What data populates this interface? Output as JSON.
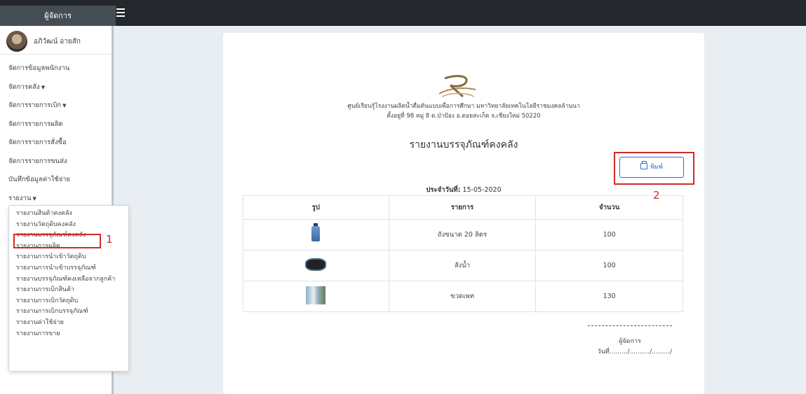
{
  "topbar": {
    "brand": "ผู้จัดการ"
  },
  "user": {
    "name": "อภิวัฒน์ อายสัก"
  },
  "nav": [
    {
      "label": "จัดการข้อมูลพนักงาน",
      "caret": ""
    },
    {
      "label": "จัดการคลัง",
      "caret": "▼"
    },
    {
      "label": "จัดการรายการเบิก",
      "caret": "▼"
    },
    {
      "label": "จัดการรายการผลิต",
      "caret": ""
    },
    {
      "label": "จัดการรายการสั่งซื้อ",
      "caret": ""
    },
    {
      "label": "จัดการรายการขนส่ง",
      "caret": ""
    },
    {
      "label": "บันทึกข้อมูลค่าใช้จ่าย",
      "caret": ""
    },
    {
      "label": "รายงาน",
      "caret": "▼"
    }
  ],
  "report_menu": [
    "รายงานสินค้าคงคลัง",
    "รายงานวัตถุดิบคงคลัง",
    "รายงานบรรจุภัณฑ์คงคลัง",
    "รายงานการผลิต",
    "รายงานการนำเข้าวัตถุดิบ",
    "รายงานการนำเข้าบรรจุภัณฑ์",
    "รายงานบรรจุภัณฑ์คงเหลือจากลูกค้า",
    "รายงานการเบิกสินค้า",
    "รายงานการเบิกวัตถุดิบ",
    "รายงานการเบิกบรรจุภัณฑ์",
    "รายงานค่าใช้จ่าย",
    "รายงานการขาย"
  ],
  "annotations": {
    "marker1": "1",
    "marker2": "2",
    "color": "#d12a2a"
  },
  "report": {
    "org_line1": "ศูนย์เรียนรู้โรงงานผลิตน้ำดื่มต้นแบบเพื่อการศึกษา มหาวิทยาลัยเทคโนโลยีราชมงคลล้านนา",
    "org_line2": "ตั้งอยู่ที่ 98 หมู่ 8 ต.ป่าป้อง อ.ดอยสะเก็ด จ.เชียงใหม่ 50220",
    "title": "รายงานบรรจุภัณฑ์คงคลัง",
    "print_label": "พิมพ์",
    "date_label": "ประจำวันที่",
    "date_value": "15-05-2020",
    "columns": [
      "รูป",
      "รายการ",
      "จำนวน"
    ],
    "rows": [
      {
        "image": "water-tank-image",
        "item": "ถังขนาด 20 ลิตร",
        "qty": "100"
      },
      {
        "image": "crate-image",
        "item": "ลังน้ำ",
        "qty": "100"
      },
      {
        "image": "pet-bottle-image",
        "item": "ขวดเพท",
        "qty": "130"
      }
    ],
    "signature_line": "----------------------------",
    "signature_name": "ผู้จัดการ",
    "signature_date": "วันที่........./........../........./"
  },
  "colors": {
    "topbar": "#24282c",
    "accent_blue": "#2b6fd6",
    "annotation_red": "#d12a2a"
  }
}
